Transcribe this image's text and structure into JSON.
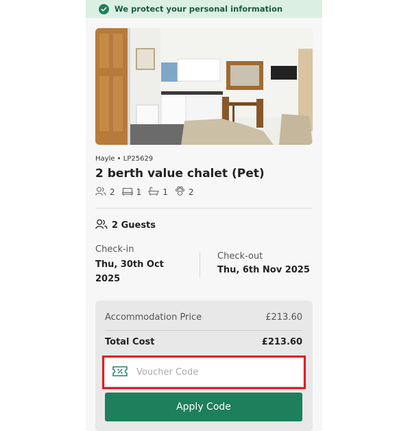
{
  "banner": {
    "text": "We protect your personal information",
    "icon": "check-circle-icon"
  },
  "property": {
    "location": "Hayle • LP25629",
    "title": "2 berth value chalet (Pet)",
    "features": [
      {
        "icon": "people-icon",
        "value": "2"
      },
      {
        "icon": "bed-icon",
        "value": "1"
      },
      {
        "icon": "bath-icon",
        "value": "1"
      },
      {
        "icon": "paw-icon",
        "value": "2"
      }
    ]
  },
  "booking": {
    "guests": "2 Guests",
    "checkin_label": "Check-in",
    "checkin_value": "Thu, 30th Oct 2025",
    "checkout_label": "Check-out",
    "checkout_value": "Thu, 6th Nov 2025"
  },
  "pricing": {
    "accommodation_label": "Accommodation Price",
    "accommodation_value": "£213.60",
    "total_label": "Total Cost",
    "total_value": "£213.60"
  },
  "voucher": {
    "placeholder": "Voucher Code",
    "value": "",
    "icon": "voucher-ticket-icon"
  },
  "apply_button": "Apply Code",
  "colors": {
    "brand_green": "#1e7f5c",
    "banner_bg": "#dcefe3",
    "highlight": "#e01b24"
  }
}
